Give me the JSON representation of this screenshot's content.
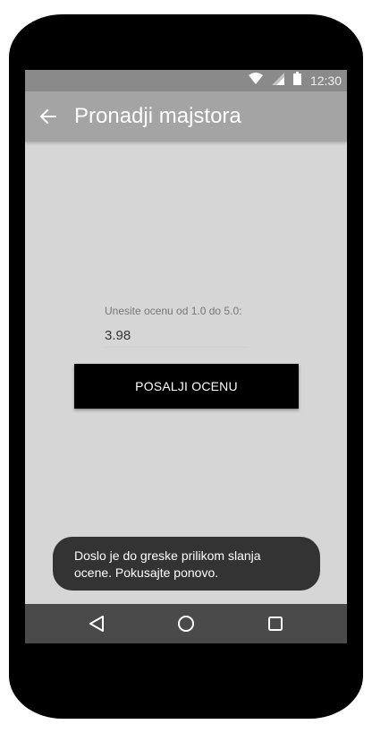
{
  "status_bar": {
    "time": "12:30",
    "icons": [
      "wifi-icon",
      "signal-icon",
      "battery-icon"
    ]
  },
  "app_bar": {
    "back_icon": "arrow-left-icon",
    "title": "Pronadji majstora"
  },
  "form": {
    "label": "Unesite ocenu od 1.0 do 5.0:",
    "rating_value": "3.98",
    "submit_label": "POSALJI OCENU"
  },
  "toast": {
    "message": "Doslo je do greske prilikom slanja ocene. Pokusajte ponovo."
  },
  "nav_bar": {
    "icons": [
      "back-triangle-icon",
      "home-circle-icon",
      "recents-square-icon"
    ]
  },
  "colors": {
    "status_bar": "#8a8a8a",
    "app_bar": "#a4a4a4",
    "background": "#d6d6d6",
    "button": "#000000",
    "toast": "#333333",
    "nav_bar": "#4a4a4a"
  }
}
